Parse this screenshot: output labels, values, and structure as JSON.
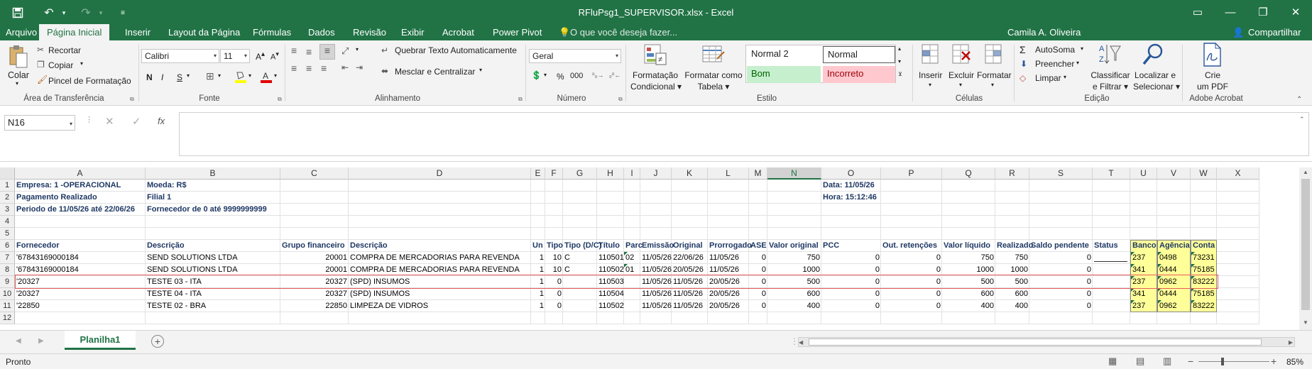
{
  "window": {
    "title": "RFluPsg1_SUPERVISOR.xlsx - Excel",
    "undo_label": "↶",
    "redo_label": "↷",
    "minimize": "—",
    "restore": "❐",
    "close": "✕"
  },
  "menu": {
    "tabs": [
      "Arquivo",
      "Página Inicial",
      "Inserir",
      "Layout da Página",
      "Fórmulas",
      "Dados",
      "Revisão",
      "Exibir",
      "Acrobat",
      "Power Pivot"
    ],
    "active_tab": "Página Inicial",
    "tell_me": "O que você deseja fazer...",
    "user": "Camila A. Oliveira",
    "share": "Compartilhar"
  },
  "ribbon": {
    "clipboard": {
      "paste": "Colar",
      "cut": "Recortar",
      "copy": "Copiar",
      "format_painter": "Pincel de Formatação",
      "label": "Área de Transferência"
    },
    "font": {
      "name": "Calibri",
      "size": "11",
      "bold": "N",
      "italic": "I",
      "underline": "S",
      "label": "Fonte"
    },
    "alignment": {
      "wrap": "Quebrar Texto Automaticamente",
      "merge": "Mesclar e Centralizar",
      "label": "Alinhamento"
    },
    "number": {
      "format": "Geral",
      "label": "Número"
    },
    "styles": {
      "conditional": "Formatação",
      "conditional2": "Condicional",
      "table": "Formatar como",
      "table2": "Tabela",
      "normal2": "Normal 2",
      "normal": "Normal",
      "bom": "Bom",
      "incorreto": "Incorreto",
      "label": "Estilo"
    },
    "cells": {
      "insert": "Inserir",
      "delete": "Excluir",
      "format": "Formatar",
      "label": "Células"
    },
    "editing": {
      "autosum": "AutoSoma",
      "fill": "Preencher",
      "clear": "Limpar",
      "sort": "Classificar",
      "sort2": "e Filtrar",
      "find": "Localizar e",
      "find2": "Selecionar",
      "label": "Edição"
    },
    "acrobat": {
      "create": "Crie",
      "create2": "um PDF",
      "label": "Adobe Acrobat"
    }
  },
  "formula_bar": {
    "name_box": "N16",
    "fx": "fx",
    "value": ""
  },
  "columns": [
    "A",
    "B",
    "C",
    "D",
    "E",
    "F",
    "G",
    "H",
    "I",
    "J",
    "K",
    "L",
    "M",
    "N",
    "O",
    "P",
    "Q",
    "R",
    "S",
    "T",
    "U",
    "V",
    "W",
    "X"
  ],
  "rows": [
    "1",
    "2",
    "3",
    "4",
    "5",
    "6",
    "7",
    "8",
    "9",
    "10",
    "11",
    "12"
  ],
  "header_info": {
    "a1": "Empresa:  1 -OPERACIONAL",
    "b1": "Moeda: R$",
    "o1": "Data: 11/05/26",
    "a2": "Pagamento Realizado",
    "b2": "Filial 1",
    "o2": "Hora: 15:12:46",
    "a3": "Periodo de 11/05/26 até 22/06/26",
    "b3": "Fornecedor de 0 até 9999999999"
  },
  "table_headers": [
    "Fornecedor",
    "Descrição",
    "Grupo financeiro",
    "Descrição",
    "Un",
    "Tipo",
    "Tipo (D/C)",
    "Título",
    "Parc",
    "Emissão",
    "Original",
    "Prorrogado",
    "ASE",
    "Valor original",
    "PCC",
    "Out. retenções",
    "Valor líquido",
    "Realizado",
    "Saldo pendente",
    "Status",
    "Banco",
    "Agência",
    "Conta"
  ],
  "table_rows": [
    [
      "'67843169000184",
      "SEND SOLUTIONS LTDA",
      "20001",
      "COMPRA DE MERCADORIAS PARA REVENDA",
      "1",
      "10",
      "C",
      "110501",
      "02",
      "11/05/26",
      "22/06/26",
      "11/05/26",
      "0",
      "750",
      "0",
      "0",
      "750",
      "750",
      "0",
      "",
      "237",
      "0498",
      "73231"
    ],
    [
      "'67843169000184",
      "SEND SOLUTIONS LTDA",
      "20001",
      "COMPRA DE MERCADORIAS PARA REVENDA",
      "1",
      "10",
      "C",
      "110502",
      "01",
      "11/05/26",
      "20/05/26",
      "11/05/26",
      "0",
      "1000",
      "0",
      "0",
      "1000",
      "1000",
      "0",
      "",
      "341",
      "0444",
      "75185"
    ],
    [
      "'20327",
      "TESTE 03 - ITA",
      "20327",
      "(SPD) INSUMOS",
      "1",
      "0",
      "",
      "110503",
      "",
      "11/05/26",
      "11/05/26",
      "20/05/26",
      "0",
      "500",
      "0",
      "0",
      "500",
      "500",
      "0",
      "",
      "237",
      "0962",
      "83222"
    ],
    [
      "'20327",
      "TESTE 04 - ITA",
      "20327",
      "(SPD) INSUMOS",
      "1",
      "0",
      "",
      "110504",
      "",
      "11/05/26",
      "11/05/26",
      "20/05/26",
      "0",
      "600",
      "0",
      "0",
      "600",
      "600",
      "0",
      "",
      "341",
      "0444",
      "75185"
    ],
    [
      "'22850",
      "TESTE 02 - BRA",
      "22850",
      " LIMPEZA DE VIDROS",
      "1",
      "0",
      "",
      "110502",
      "",
      "11/05/26",
      "11/05/26",
      "20/05/26",
      "0",
      "400",
      "0",
      "0",
      "400",
      "400",
      "0",
      "",
      "237",
      "0962",
      "83222"
    ]
  ],
  "sheet": {
    "tab": "Planilha1",
    "add": "+"
  },
  "status": {
    "ready": "Pronto",
    "zoom": "85%",
    "minus": "−",
    "plus": "+"
  }
}
